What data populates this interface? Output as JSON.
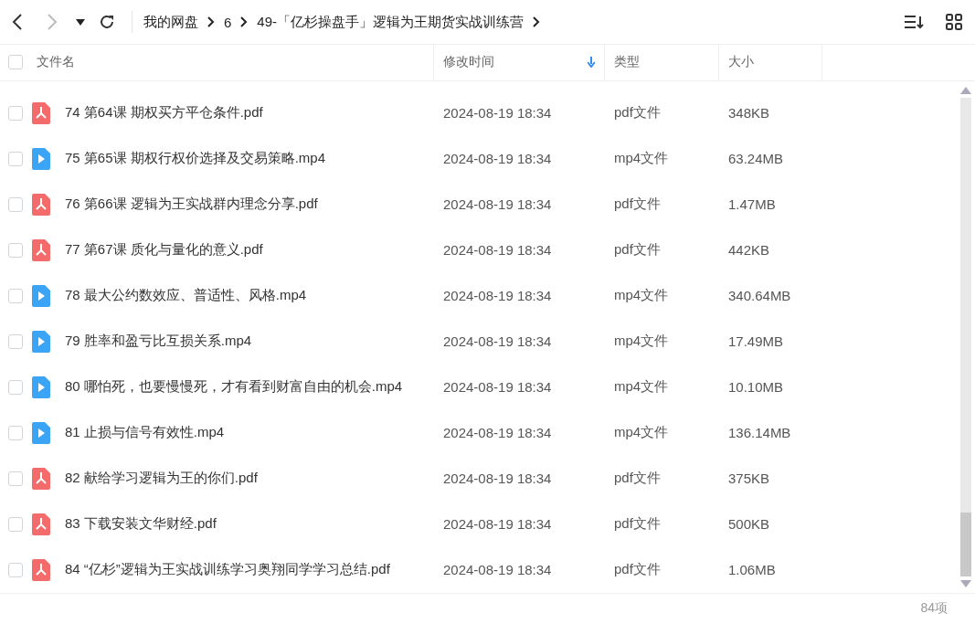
{
  "breadcrumb": [
    "我的网盘",
    "6",
    "49-「亿杉操盘手」逻辑为王期货实战训练营"
  ],
  "columns": [
    {
      "label": "文件名",
      "sorted": false
    },
    {
      "label": "修改时间",
      "sorted": true
    },
    {
      "label": "类型",
      "sorted": false
    },
    {
      "label": "大小",
      "sorted": false
    }
  ],
  "rows": [
    {
      "kind": "pdf",
      "checked": false,
      "name": "74 第64课 期权买方平仓条件.pdf",
      "modified": "2024-08-19 18:34",
      "type": "pdf文件",
      "size": "348KB"
    },
    {
      "kind": "video",
      "checked": false,
      "name": "75 第65课 期权行权价选择及交易策略.mp4",
      "modified": "2024-08-19 18:34",
      "type": "mp4文件",
      "size": "63.24MB"
    },
    {
      "kind": "pdf",
      "checked": false,
      "name": "76 第66课 逻辑为王实战群内理念分享.pdf",
      "modified": "2024-08-19 18:34",
      "type": "pdf文件",
      "size": "1.47MB"
    },
    {
      "kind": "pdf",
      "checked": false,
      "name": "77 第67课 质化与量化的意义.pdf",
      "modified": "2024-08-19 18:34",
      "type": "pdf文件",
      "size": "442KB"
    },
    {
      "kind": "video",
      "checked": false,
      "name": "78 最大公约数效应、普适性、风格.mp4",
      "modified": "2024-08-19 18:34",
      "type": "mp4文件",
      "size": "340.64MB"
    },
    {
      "kind": "video",
      "checked": false,
      "name": "79 胜率和盈亏比互损关系.mp4",
      "modified": "2024-08-19 18:34",
      "type": "mp4文件",
      "size": "17.49MB"
    },
    {
      "kind": "video",
      "checked": false,
      "name": "80 哪怕死，也要慢慢死，才有看到财富自由的机会.mp4",
      "modified": "2024-08-19 18:34",
      "type": "mp4文件",
      "size": "10.10MB"
    },
    {
      "kind": "video",
      "checked": false,
      "name": "81 止损与信号有效性.mp4",
      "modified": "2024-08-19 18:34",
      "type": "mp4文件",
      "size": "136.14MB"
    },
    {
      "kind": "pdf",
      "checked": false,
      "name": "82 献给学习逻辑为王的你们.pdf",
      "modified": "2024-08-19 18:34",
      "type": "pdf文件",
      "size": "375KB"
    },
    {
      "kind": "pdf",
      "checked": false,
      "name": "83 下载安装文华财经.pdf",
      "modified": "2024-08-19 18:34",
      "type": "pdf文件",
      "size": "500KB"
    },
    {
      "kind": "pdf",
      "checked": false,
      "name": "84 “亿杉”逻辑为王实战训练学习奥翔同学学习总结.pdf",
      "modified": "2024-08-19 18:34",
      "type": "pdf文件",
      "size": "1.06MB"
    }
  ],
  "select_all": {
    "checked": false
  },
  "status_bar": {
    "count": "84项"
  }
}
